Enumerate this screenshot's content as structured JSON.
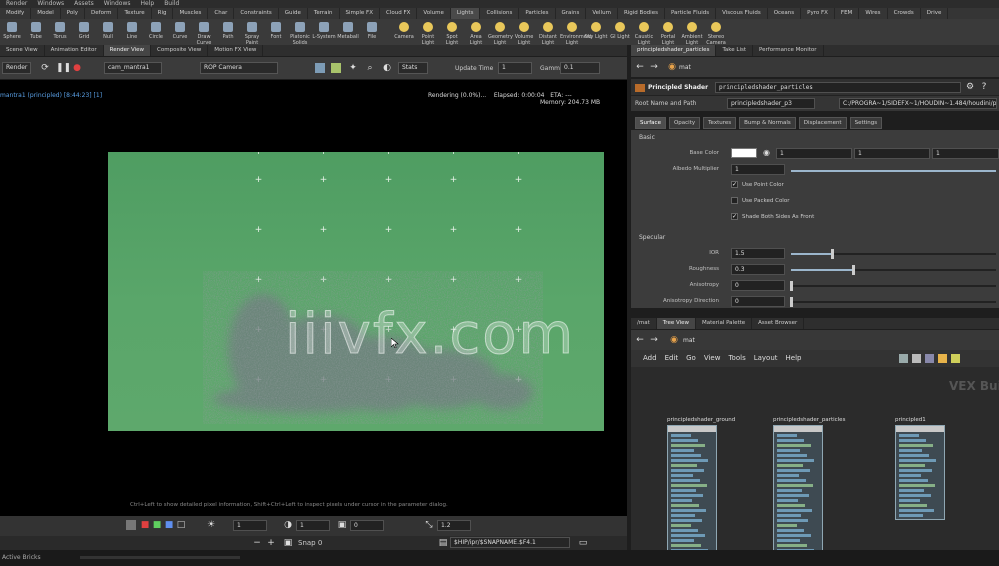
{
  "menubar": {
    "items": [
      "Render",
      "Windows",
      "Assets",
      "Windows",
      "Help",
      "Build"
    ]
  },
  "shelf": {
    "tabs": [
      "Modify",
      "Model",
      "Poly",
      "Deform",
      "Texture",
      "Rig",
      "Muscles",
      "Char",
      "Constraints",
      "Guide",
      "Terrain",
      "Simple FX",
      "Cloud FX",
      "Volume",
      "Lights",
      "Collisions",
      "Particles",
      "Grains",
      "Vellum",
      "Rigid Bodies",
      "Particle Fluids",
      "Viscous Fluids",
      "Oceans",
      "Pyro FX",
      "FEM",
      "Wires",
      "Crowds",
      "Drive"
    ],
    "tools": [
      "Sphere",
      "Tube",
      "Torus",
      "Grid",
      "Null",
      "Line",
      "Circle",
      "Curve",
      "Draw Curve",
      "Path",
      "Spray Paint",
      "Font",
      "Platonic Solids",
      "L-System",
      "Metaball",
      "File"
    ],
    "light_tools": [
      "Camera",
      "Point Light",
      "Spot Light",
      "Area Light",
      "Geometry Light",
      "Volume Light",
      "Distant Light",
      "Environment Light",
      "Sky Light",
      "GI Light",
      "Caustic Light",
      "Portal Light",
      "Ambient Light",
      "Stereo Camera"
    ]
  },
  "viewport_tabs": [
    "Scene View",
    "Animation Editor",
    "Render View",
    "Composite View",
    "Motion FX View"
  ],
  "param_tabs": [
    "principledshader_particles",
    "Take List",
    "Performance Monitor"
  ],
  "viewport_toolbar": {
    "render_button": "Render",
    "camera_value": "cam_mantra1",
    "rop_value": "ROP Camera",
    "snapshot_label": "Stats",
    "update_time_label": "Update Time",
    "update_time_value": "1",
    "gamma_label": "Gamma",
    "gamma_value": "0.1"
  },
  "viewport": {
    "left_info": "mantra1 (principled) [8:44:23] [1]",
    "rendering": "Rendering (0.0%)...",
    "elapsed_label": "Elapsed:",
    "elapsed_value": "0:00:04",
    "eta_label": "ETA:",
    "eta_value": "---",
    "memory_label": "Memory:",
    "memory_value": "204.73 MB",
    "hint": "Ctrl+Left to show detailed pixel information, Shift+Ctrl+Left to inspect pixels under cursor in the parameter dialog.",
    "watermark": "iiivfx.com"
  },
  "viewport_bottom": {
    "frame_value": "1",
    "frame2_value": "1",
    "frame3_value": "0",
    "zoom_value": "1.2",
    "snap_label": "Snap 0",
    "path": "$HIP/ipr/$SNAPNAME.$F4.1"
  },
  "status": {
    "label": "Active Bricks"
  },
  "param_pane": {
    "obj_path": "mat",
    "shader_type": "Principled Shader",
    "shader_name": "principledshader_particles",
    "root_label": "Root Name and Path",
    "root_value": "principledshader_p3",
    "path_value": "C:/PROGRA~1/SIDEFX~1/HOUDIN~1.484/houdini/p",
    "subtabs": [
      "Surface",
      "Opacity",
      "Textures",
      "Bump & Normals",
      "Displacement",
      "Settings"
    ],
    "sections": {
      "basic": "Basic",
      "specular": "Specular"
    },
    "base_color": {
      "label": "Base Color",
      "r": "1",
      "g": "1",
      "b": "1"
    },
    "albedo_multiplier": {
      "label": "Albedo Multiplier",
      "value": "1"
    },
    "checks": [
      {
        "label": "Use Point Color",
        "checked": true
      },
      {
        "label": "Use Packed Color",
        "checked": false
      },
      {
        "label": "Shade Both Sides As Front",
        "checked": true
      }
    ],
    "specular": [
      {
        "label": "IOR",
        "value": "1.5",
        "fill": 0.2
      },
      {
        "label": "Roughness",
        "value": "0.3",
        "fill": 0.3
      },
      {
        "label": "Anisotropy",
        "value": "0",
        "fill": 0
      },
      {
        "label": "Anisotropy Direction",
        "value": "0",
        "fill": 0
      }
    ]
  },
  "net_pane": {
    "tabs": [
      "/mat",
      "Tree View",
      "Material Palette",
      "Asset Browser"
    ],
    "path": "mat",
    "menu": [
      "Add",
      "Edit",
      "Go",
      "View",
      "Tools",
      "Layout",
      "Help"
    ],
    "watermark": "VEX Builder",
    "nodes": [
      {
        "name": "principledshader_ground"
      },
      {
        "name": "principledshader_particles"
      },
      {
        "name": "principled1"
      }
    ]
  },
  "colors": {
    "green_screen": "#55a367",
    "accent_blue": "#5aa0e6"
  }
}
